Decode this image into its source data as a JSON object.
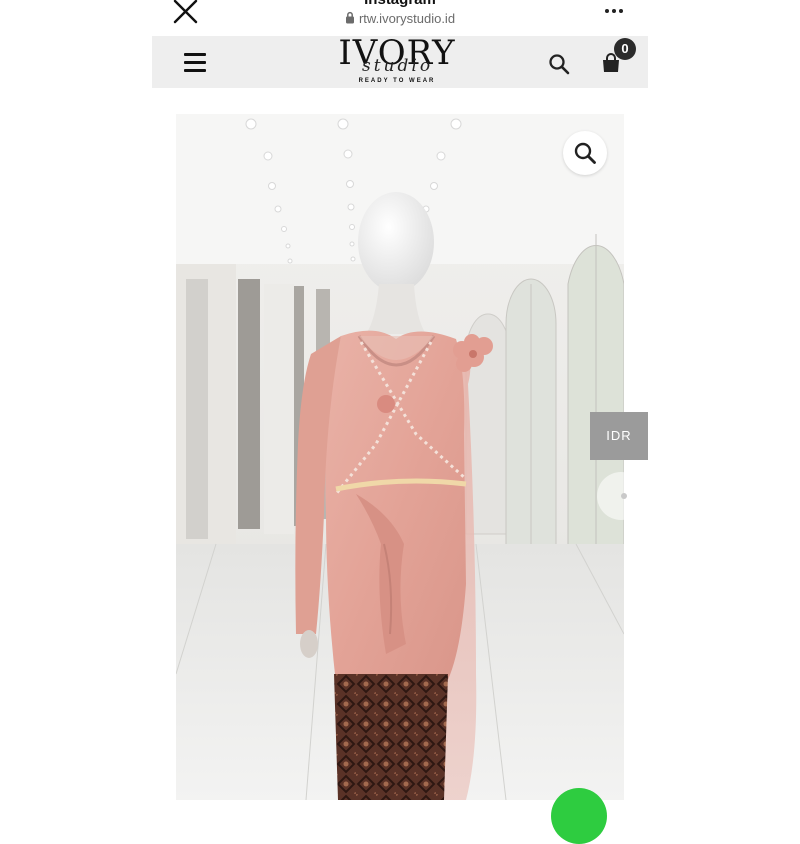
{
  "browser": {
    "app_title": "Instagram",
    "url": "rtw.ivorystudio.id"
  },
  "header": {
    "logo_word": "IVORY",
    "logo_script": "studio",
    "logo_tagline": "READY TO WEAR",
    "cart_count": "0"
  },
  "product": {
    "currency": "IDR"
  },
  "icons": {
    "close": "close-icon",
    "lock": "lock-icon",
    "more": "more-icon",
    "menu": "hamburger-menu-icon",
    "search": "search-icon",
    "cart": "shopping-bag-icon",
    "zoom": "zoom-icon",
    "chat": "whatsapp-chat-icon"
  },
  "colors": {
    "header_bg": "#eeeeee",
    "cart_badge": "#2b2b2b",
    "currency_bg": "#9b9b9b",
    "chat": "#2ecc40",
    "dress": "#e7a79c"
  }
}
